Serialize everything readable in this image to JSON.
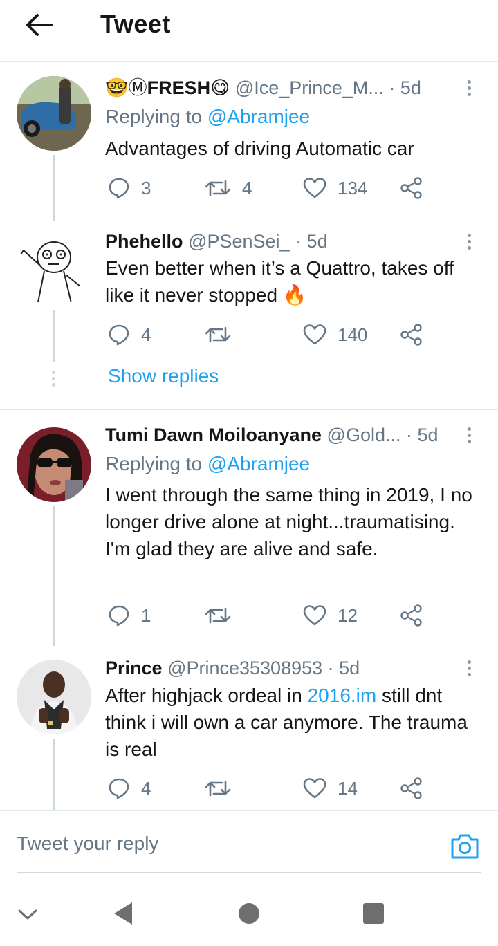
{
  "header": {
    "title": "Tweet"
  },
  "tweets": [
    {
      "name_emoji_prefix": "🤓Ⓜ",
      "name": "FRESH",
      "name_emoji_suffix": "😋",
      "handle": "@Ice_Prince_M...",
      "time": "· 5d",
      "replying_label": "Replying to",
      "replying_to": "@Abramjee",
      "text": "Advantages of driving Automatic car",
      "replies": "3",
      "retweets": "4",
      "likes": "134"
    },
    {
      "name": "Phehello",
      "handle": "@PSenSei_",
      "time": "· 5d",
      "text": "Even better when it’s a Quattro, takes off like it never stopped",
      "text_emoji": "🔥",
      "replies": "4",
      "retweets": "",
      "likes": "140"
    },
    {
      "name": "Tumi Dawn Moiloanyane",
      "handle": "@Gold...",
      "time": "· 5d",
      "replying_label": "Replying to",
      "replying_to": "@Abramjee",
      "text": "I went through the same thing in 2019, I no longer drive alone at night...traumatising. I'm glad they are alive and safe.",
      "replies": "1",
      "retweets": "",
      "likes": "12"
    },
    {
      "name": "Prince",
      "handle": "@Prince35308953",
      "time": "· 5d",
      "text_before": "After highjack ordeal in ",
      "text_link": "2016.im",
      "text_after": " still dnt think i will own a car anymore. The trauma is real",
      "replies": "4",
      "retweets": "",
      "likes": "14"
    }
  ],
  "show_replies": "Show replies",
  "reply_bar": {
    "placeholder": "Tweet your reply"
  },
  "icons": {
    "back": "arrow-left-icon",
    "more": "more-vertical-icon",
    "reply": "reply-bubble-icon",
    "retweet": "retweet-icon",
    "like": "heart-icon",
    "share": "share-icon",
    "camera": "camera-icon"
  },
  "colors": {
    "accent": "#1da1f2",
    "text": "#14171a",
    "muted": "#657786",
    "border": "#e1e8ed",
    "thread": "#ccd6dd"
  }
}
